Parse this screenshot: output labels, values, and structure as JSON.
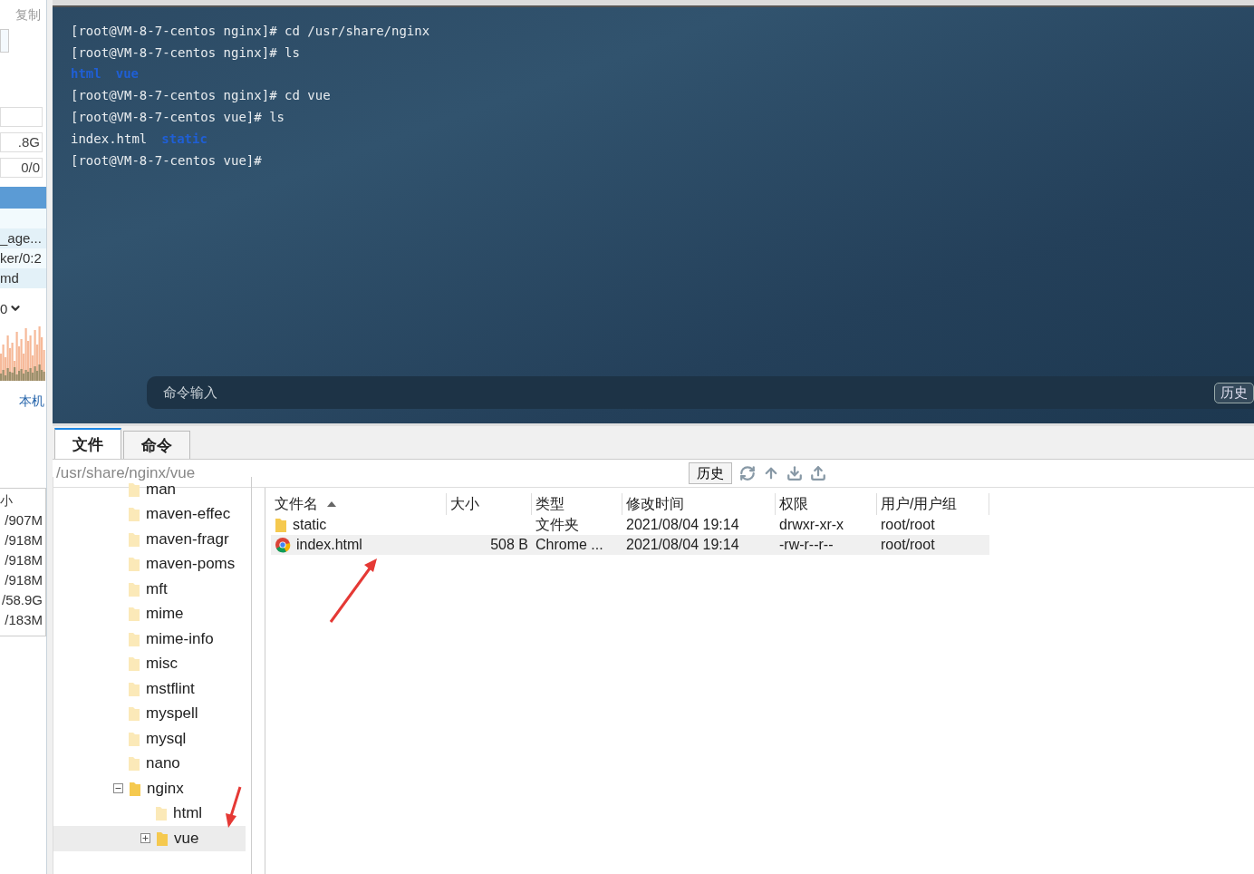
{
  "side_strip": {
    "copy_label": "复制",
    "fields": [
      ".8G",
      "0/0"
    ],
    "process_rows": [
      "_age...",
      "ker/0:2",
      "md"
    ],
    "dropdown_value": "0",
    "host_label": "本机",
    "disk_header": "小",
    "disk_rows": [
      "/907M",
      "/918M",
      "/918M",
      "/918M",
      "/58.9G",
      "/183M"
    ]
  },
  "terminal": {
    "lines": [
      {
        "parts": [
          {
            "text": "[root@VM-8-7-centos nginx]# cd /usr/share/nginx",
            "kind": "plain"
          }
        ]
      },
      {
        "parts": [
          {
            "text": "[root@VM-8-7-centos nginx]# ls",
            "kind": "plain"
          }
        ]
      },
      {
        "parts": [
          {
            "text": "html",
            "kind": "dir"
          },
          {
            "text": "vue",
            "kind": "dir"
          }
        ]
      },
      {
        "parts": [
          {
            "text": "[root@VM-8-7-centos nginx]# cd vue",
            "kind": "plain"
          }
        ]
      },
      {
        "parts": [
          {
            "text": "[root@VM-8-7-centos vue]# ls",
            "kind": "plain"
          }
        ]
      },
      {
        "parts": [
          {
            "text": "index.html",
            "kind": "plain"
          },
          {
            "text": "static",
            "kind": "dir"
          }
        ]
      },
      {
        "parts": [
          {
            "text": "[root@VM-8-7-centos vue]#",
            "kind": "plain"
          }
        ]
      }
    ],
    "input_placeholder": "命令输入",
    "history_button": "历史"
  },
  "tabs": [
    {
      "label": "文件",
      "selected": true
    },
    {
      "label": "命令",
      "selected": false
    }
  ],
  "path_bar": {
    "value": "/usr/share/nginx/vue",
    "history_button": "历史"
  },
  "tree": [
    {
      "label": "man",
      "expandable": false,
      "selected": false
    },
    {
      "label": "maven-effec",
      "expandable": false,
      "selected": false
    },
    {
      "label": "maven-fragr",
      "expandable": false,
      "selected": false
    },
    {
      "label": "maven-poms",
      "expandable": false,
      "selected": false
    },
    {
      "label": "mft",
      "expandable": false,
      "selected": false
    },
    {
      "label": "mime",
      "expandable": false,
      "selected": false
    },
    {
      "label": "mime-info",
      "expandable": false,
      "selected": false
    },
    {
      "label": "misc",
      "expandable": false,
      "selected": false
    },
    {
      "label": "mstflint",
      "expandable": false,
      "selected": false
    },
    {
      "label": "myspell",
      "expandable": false,
      "selected": false
    },
    {
      "label": "mysql",
      "expandable": false,
      "selected": false
    },
    {
      "label": "nano",
      "expandable": false,
      "selected": false
    },
    {
      "label": "nginx",
      "expandable": true,
      "expanded": true,
      "selected": false,
      "children": [
        {
          "label": "html",
          "expandable": false,
          "selected": false
        },
        {
          "label": "vue",
          "expandable": true,
          "expanded": false,
          "selected": true
        }
      ]
    }
  ],
  "file_table": {
    "columns": [
      "文件名",
      "大小",
      "类型",
      "修改时间",
      "权限",
      "用户/用户组"
    ],
    "rows": [
      {
        "kind": "folder",
        "selected": false,
        "cells": [
          "static",
          "",
          "文件夹",
          "2021/08/04 19:14",
          "drwxr-xr-x",
          "root/root"
        ]
      },
      {
        "kind": "html",
        "selected": true,
        "cells": [
          "index.html",
          "508 B",
          "Chrome ...",
          "2021/08/04 19:14",
          "-rw-r--r--",
          "root/root"
        ]
      }
    ]
  }
}
